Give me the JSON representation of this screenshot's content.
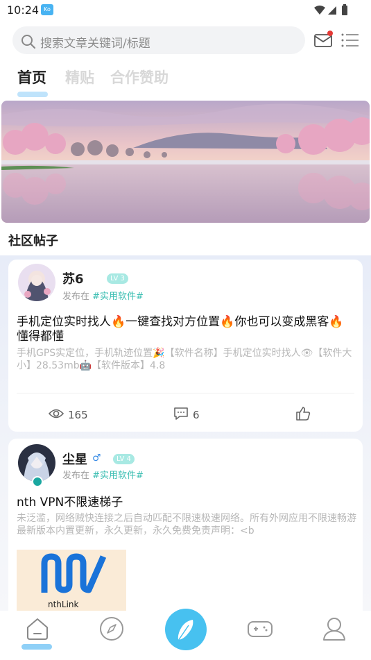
{
  "status_bar": {
    "time": "10:24",
    "app_icon_text": "Ko"
  },
  "search": {
    "placeholder": "搜索文章关键词/标题"
  },
  "tabs": [
    {
      "label": "首页",
      "active": true
    },
    {
      "label": "精贴",
      "active": false
    },
    {
      "label": "合作赞助",
      "active": false
    }
  ],
  "section": {
    "title": "社区帖子"
  },
  "posts": [
    {
      "username": "苏6",
      "gender_icon": "",
      "level": "LV 3",
      "posted_in_label": "发布在",
      "category": "#实用软件#",
      "title": "手机定位实时找人🔥一键查找对方位置🔥你也可以变成黑客🔥懂得都懂",
      "excerpt": "手机GPS实定位，手机轨迹位置🎉【软件名称】手机定位实时找人👁【软件大小】28.53mb🤖【软件版本】4.8",
      "views": "165",
      "comments": "6"
    },
    {
      "username": "尘星",
      "gender_icon": "♂",
      "level": "LV 4",
      "posted_in_label": "发布在",
      "category": "#实用软件#",
      "title": "nth VPN不限速梯子",
      "excerpt": "未泛滥，网络贼快连接之后自动匹配不限速极速网络。所有外网应用不限速畅游最新版本内置更新，永久更新，永久免费免责声明：<b",
      "image_label": "nthLink"
    }
  ],
  "colors": {
    "accent": "#47c1f0",
    "category": "#3ebfb3",
    "notification_dot": "#e53935"
  },
  "icons": [
    "search-icon",
    "mail-icon",
    "menu-icon",
    "eye-icon",
    "comment-icon",
    "thumbs-up-icon",
    "home-icon",
    "compass-icon",
    "feather-icon",
    "gamepad-icon",
    "user-icon"
  ]
}
